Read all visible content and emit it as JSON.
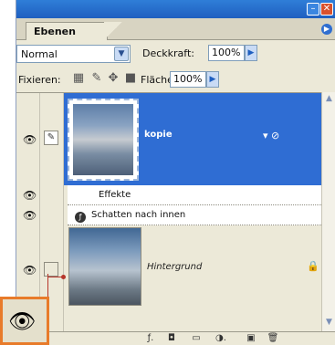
{
  "panel": {
    "tab_label": "Ebenen",
    "blend_mode": "Normal",
    "opacity_label": "Deckkraft:",
    "opacity_value": "100%",
    "lock_label": "Fixieren:",
    "fill_label": "Fläche",
    "fill_value": "100%"
  },
  "layers": [
    {
      "name": "kopie",
      "selected": true,
      "visible": true,
      "has_effects": true
    },
    {
      "name": "Hintergrund",
      "selected": false,
      "visible": true,
      "locked": true
    }
  ],
  "effects": {
    "header": "Effekte",
    "items": [
      "Schatten nach innen"
    ]
  },
  "icons": {
    "eye": "eye-icon",
    "brush": "brush-icon",
    "lock": "lock-icon",
    "fx": "fx-icon"
  },
  "colors": {
    "titlebar": "#1f5fc0",
    "selected_row": "#2f6dd3",
    "callout_border": "#e87b2a"
  }
}
